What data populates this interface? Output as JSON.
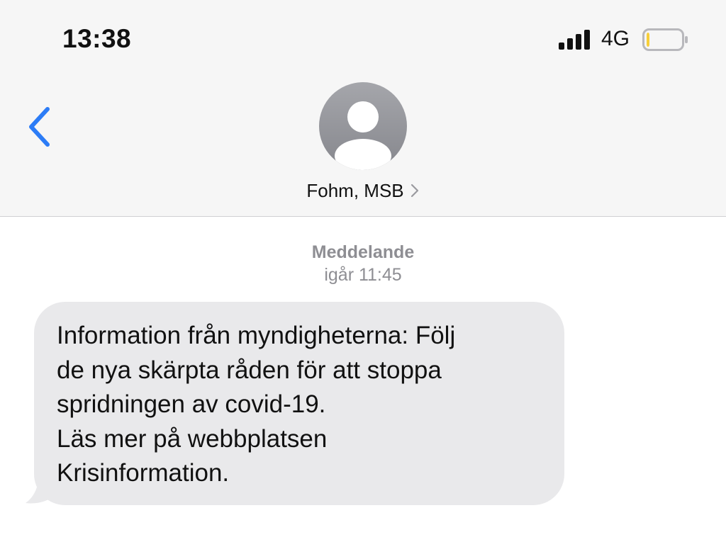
{
  "status_bar": {
    "time": "13:38",
    "network": "4G",
    "signal_icon": "signal-bars-icon",
    "battery_icon": "battery-low-icon",
    "battery_level": 0.08,
    "battery_color": "#f7cf3a"
  },
  "nav": {
    "back_icon": "chevron-left-icon",
    "accent_color": "#2c7cf6",
    "contact_avatar_icon": "person-avatar-icon",
    "contact_name": "Fohm, MSB",
    "contact_chevron_icon": "chevron-right-icon"
  },
  "conversation": {
    "meta_label": "Meddelande",
    "meta_time": "igår 11:45",
    "messages": [
      {
        "direction": "incoming",
        "lines": [
          "Information från myndigheterna: Följ",
          "de nya skärpta råden för att stoppa",
          "spridningen av covid-19.",
          "Läs mer på webbplatsen",
          "Krisinformation."
        ]
      }
    ]
  },
  "colors": {
    "header_bg": "#f6f6f6",
    "bubble_bg": "#e9e9eb",
    "meta_text": "#8e8e93"
  }
}
